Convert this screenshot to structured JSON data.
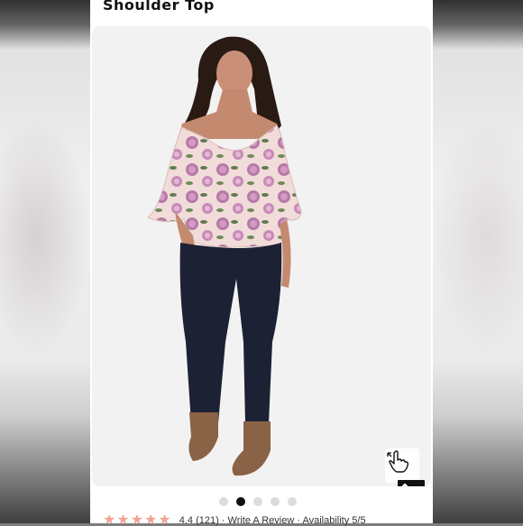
{
  "product": {
    "title": "Shoulder Top"
  },
  "gallery": {
    "total_slides": 5,
    "active_slide": 2
  },
  "controls": {
    "zoom_icon": "pointing-hand-icon",
    "scroll_top_icon": "chevron-up-icon"
  },
  "reviews": {
    "stars": "★★★★★",
    "rating_value": 0.9,
    "summary": "4.4 (121)  ·  Write A Review  ·  Availability 5/5"
  },
  "colors": {
    "card_background": "#ffffff",
    "dot_active": "#111111",
    "dot_inactive": "#dcdcdc",
    "star_color": "#f0a590",
    "scroll_top_bg": "#111111"
  }
}
